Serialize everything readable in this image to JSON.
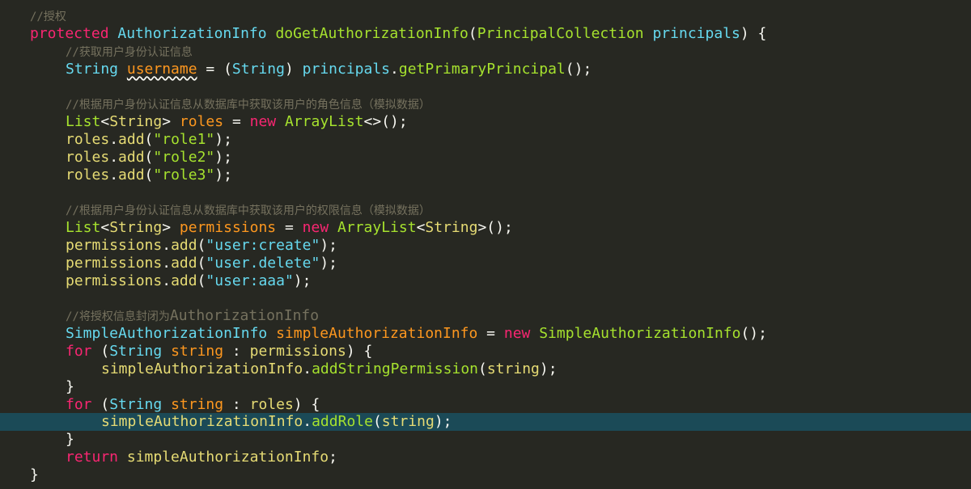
{
  "editor": {
    "theme_colors": {
      "background": "#272822",
      "current_line": "#1b4a57",
      "keyword": "#f92672",
      "type": "#66d9ef",
      "function": "#a6e22e",
      "variable": "#fd971f",
      "string": "#e6db74",
      "comment": "#75715e"
    },
    "current_line_index": 23,
    "lines": [
      {
        "indent": 0,
        "tokens": [
          {
            "t": "//授权",
            "c": "cm"
          }
        ]
      },
      {
        "indent": 0,
        "tokens": [
          {
            "t": "protected ",
            "c": "kw"
          },
          {
            "t": "AuthorizationInfo ",
            "c": "type"
          },
          {
            "t": "doGetAuthorizationInfo",
            "c": "fn"
          },
          {
            "t": "(",
            "c": "punc"
          },
          {
            "t": "PrincipalCollection ",
            "c": "fn"
          },
          {
            "t": "principals",
            "c": "type"
          },
          {
            "t": ") {",
            "c": "punc"
          }
        ]
      },
      {
        "indent": 1,
        "tokens": [
          {
            "t": "//获取用户身份认证信息",
            "c": "cm"
          }
        ]
      },
      {
        "indent": 1,
        "tokens": [
          {
            "t": "String ",
            "c": "type"
          },
          {
            "t": "username",
            "c": "var",
            "squiggle": true
          },
          {
            "t": " = (",
            "c": "punc"
          },
          {
            "t": "String",
            "c": "type"
          },
          {
            "t": ") ",
            "c": "punc"
          },
          {
            "t": "principals",
            "c": "type"
          },
          {
            "t": ".",
            "c": "punc"
          },
          {
            "t": "getPrimaryPrincipal",
            "c": "fn"
          },
          {
            "t": "();",
            "c": "punc"
          }
        ]
      },
      {
        "indent": 0,
        "tokens": []
      },
      {
        "indent": 1,
        "tokens": [
          {
            "t": "//根据用户身份认证信息从数据库中获取该用户的角色信息（模拟数据）",
            "c": "cm"
          }
        ]
      },
      {
        "indent": 1,
        "tokens": [
          {
            "t": "List",
            "c": "fn"
          },
          {
            "t": "<",
            "c": "punc"
          },
          {
            "t": "String",
            "c": "yvar"
          },
          {
            "t": "> ",
            "c": "punc"
          },
          {
            "t": "roles",
            "c": "var"
          },
          {
            "t": " = ",
            "c": "punc"
          },
          {
            "t": "new ",
            "c": "kw"
          },
          {
            "t": "ArrayList",
            "c": "fn"
          },
          {
            "t": "<>();",
            "c": "punc"
          }
        ]
      },
      {
        "indent": 1,
        "tokens": [
          {
            "t": "roles",
            "c": "yvar"
          },
          {
            "t": ".",
            "c": "punc"
          },
          {
            "t": "add",
            "c": "yvar"
          },
          {
            "t": "(",
            "c": "punc"
          },
          {
            "t": "\"role1\"",
            "c": "fn"
          },
          {
            "t": ");",
            "c": "punc"
          }
        ]
      },
      {
        "indent": 1,
        "tokens": [
          {
            "t": "roles",
            "c": "yvar"
          },
          {
            "t": ".",
            "c": "punc"
          },
          {
            "t": "add",
            "c": "yvar"
          },
          {
            "t": "(",
            "c": "punc"
          },
          {
            "t": "\"role2\"",
            "c": "fn"
          },
          {
            "t": ");",
            "c": "punc"
          }
        ]
      },
      {
        "indent": 1,
        "tokens": [
          {
            "t": "roles",
            "c": "yvar"
          },
          {
            "t": ".",
            "c": "punc"
          },
          {
            "t": "add",
            "c": "yvar"
          },
          {
            "t": "(",
            "c": "punc"
          },
          {
            "t": "\"role3\"",
            "c": "fn"
          },
          {
            "t": ");",
            "c": "punc"
          }
        ]
      },
      {
        "indent": 0,
        "tokens": []
      },
      {
        "indent": 1,
        "tokens": [
          {
            "t": "//根据用户身份认证信息从数据库中获取该用户的权限信息（模拟数据）",
            "c": "cm"
          }
        ]
      },
      {
        "indent": 1,
        "tokens": [
          {
            "t": "List",
            "c": "fn"
          },
          {
            "t": "<",
            "c": "punc"
          },
          {
            "t": "String",
            "c": "yvar"
          },
          {
            "t": "> ",
            "c": "punc"
          },
          {
            "t": "permissions",
            "c": "var"
          },
          {
            "t": " = ",
            "c": "punc"
          },
          {
            "t": "new ",
            "c": "kw"
          },
          {
            "t": "ArrayList",
            "c": "fn"
          },
          {
            "t": "<",
            "c": "punc"
          },
          {
            "t": "String",
            "c": "yvar"
          },
          {
            "t": ">();",
            "c": "punc"
          }
        ]
      },
      {
        "indent": 1,
        "tokens": [
          {
            "t": "permissions",
            "c": "yvar"
          },
          {
            "t": ".",
            "c": "punc"
          },
          {
            "t": "add",
            "c": "yvar"
          },
          {
            "t": "(",
            "c": "punc"
          },
          {
            "t": "\"user:create\"",
            "c": "type"
          },
          {
            "t": ");",
            "c": "punc"
          }
        ]
      },
      {
        "indent": 1,
        "tokens": [
          {
            "t": "permissions",
            "c": "yvar"
          },
          {
            "t": ".",
            "c": "punc"
          },
          {
            "t": "add",
            "c": "yvar"
          },
          {
            "t": "(",
            "c": "punc"
          },
          {
            "t": "\"user.delete\"",
            "c": "type"
          },
          {
            "t": ");",
            "c": "punc"
          }
        ]
      },
      {
        "indent": 1,
        "tokens": [
          {
            "t": "permissions",
            "c": "yvar"
          },
          {
            "t": ".",
            "c": "punc"
          },
          {
            "t": "add",
            "c": "yvar"
          },
          {
            "t": "(",
            "c": "punc"
          },
          {
            "t": "\"user:aaa\"",
            "c": "type"
          },
          {
            "t": ");",
            "c": "punc"
          }
        ]
      },
      {
        "indent": 0,
        "tokens": []
      },
      {
        "indent": 1,
        "tokens": [
          {
            "t": "//将授权信息封闭为",
            "c": "cm"
          },
          {
            "t": "AuthorizationInfo",
            "c": "cm-mixed"
          }
        ]
      },
      {
        "indent": 1,
        "tokens": [
          {
            "t": "SimpleAuthorizationInfo ",
            "c": "type"
          },
          {
            "t": "simpleAuthorizationInfo",
            "c": "var"
          },
          {
            "t": " = ",
            "c": "punc"
          },
          {
            "t": "new ",
            "c": "kw"
          },
          {
            "t": "SimpleAuthorizationInfo",
            "c": "fn"
          },
          {
            "t": "();",
            "c": "punc"
          }
        ]
      },
      {
        "indent": 1,
        "tokens": [
          {
            "t": "for ",
            "c": "kw"
          },
          {
            "t": "(",
            "c": "punc"
          },
          {
            "t": "String ",
            "c": "type"
          },
          {
            "t": "string",
            "c": "var"
          },
          {
            "t": " : ",
            "c": "punc"
          },
          {
            "t": "permissions",
            "c": "yvar"
          },
          {
            "t": ") {",
            "c": "punc"
          }
        ]
      },
      {
        "indent": 2,
        "tokens": [
          {
            "t": "simpleAuthorizationInfo",
            "c": "yvar"
          },
          {
            "t": ".",
            "c": "punc"
          },
          {
            "t": "addStringPermission",
            "c": "fn"
          },
          {
            "t": "(",
            "c": "punc"
          },
          {
            "t": "string",
            "c": "yvar"
          },
          {
            "t": ");",
            "c": "punc"
          }
        ]
      },
      {
        "indent": 1,
        "tokens": [
          {
            "t": "}",
            "c": "punc"
          }
        ]
      },
      {
        "indent": 1,
        "tokens": [
          {
            "t": "for ",
            "c": "kw"
          },
          {
            "t": "(",
            "c": "punc"
          },
          {
            "t": "String ",
            "c": "type"
          },
          {
            "t": "string",
            "c": "var"
          },
          {
            "t": " : ",
            "c": "punc"
          },
          {
            "t": "roles",
            "c": "yvar"
          },
          {
            "t": ") {",
            "c": "punc"
          }
        ]
      },
      {
        "indent": 2,
        "tokens": [
          {
            "t": "simpleAuthorizationInfo",
            "c": "yvar"
          },
          {
            "t": ".",
            "c": "punc"
          },
          {
            "t": "addRole",
            "c": "fn"
          },
          {
            "t": "(",
            "c": "punc"
          },
          {
            "t": "string",
            "c": "yvar"
          },
          {
            "t": ");",
            "c": "punc"
          }
        ]
      },
      {
        "indent": 1,
        "tokens": [
          {
            "t": "}",
            "c": "punc"
          }
        ]
      },
      {
        "indent": 1,
        "tokens": [
          {
            "t": "return ",
            "c": "kw"
          },
          {
            "t": "simpleAuthorizationInfo",
            "c": "yvar"
          },
          {
            "t": ";",
            "c": "punc"
          }
        ]
      },
      {
        "indent": 0,
        "tokens": [
          {
            "t": "}",
            "c": "punc"
          }
        ]
      }
    ]
  }
}
